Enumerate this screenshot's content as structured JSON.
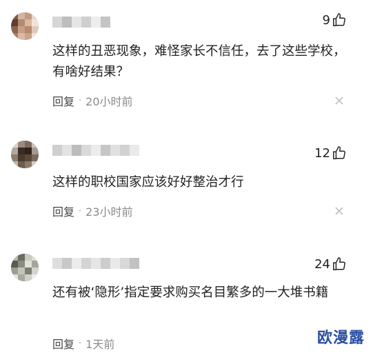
{
  "comments": [
    {
      "likes": "9",
      "text": "这样的丑恶现象，难怪家长不信任，去了这些学校，有啥好结果？",
      "reply_label": "回复",
      "separator": "·",
      "time": "20小时前"
    },
    {
      "likes": "12",
      "text": "这样的职校国家应该好好整治才行",
      "reply_label": "回复",
      "separator": "·",
      "time": "23小时前"
    },
    {
      "likes": "24",
      "text": "还有被‘隐形’指定要求购买名目繁多的一大堆书籍",
      "reply_label": "回复",
      "separator": "·",
      "time": "1天前"
    }
  ],
  "icons": {
    "like": "thumbs-up-icon",
    "close": "close-icon"
  },
  "watermark": "欧漫露",
  "colors": {
    "text": "#222222",
    "meta": "#8a8a8a",
    "watermark": "#2a4fa0"
  }
}
